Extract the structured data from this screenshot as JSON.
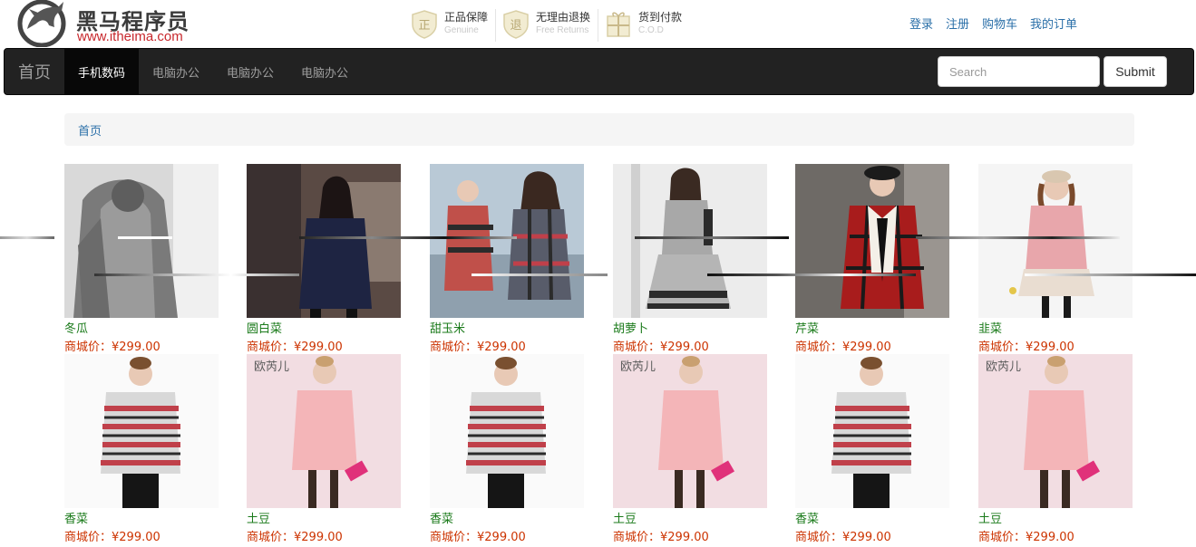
{
  "header": {
    "logo_text": "黑马程序员",
    "logo_url": "www.itheima.com",
    "promises": [
      {
        "icon": "genuine-shield-icon",
        "title": "正品保障",
        "subtitle": "Genuine"
      },
      {
        "icon": "return-shield-icon",
        "title": "无理由退换",
        "subtitle": "Free Returns"
      },
      {
        "icon": "gift-box-icon",
        "title": "货到付款",
        "subtitle": "C.O.D"
      }
    ],
    "links": [
      "登录",
      "注册",
      "购物车",
      "我的订单"
    ]
  },
  "navbar": {
    "brand": "首页",
    "items": [
      {
        "label": "手机数码",
        "active": true
      },
      {
        "label": "电脑办公",
        "active": false
      },
      {
        "label": "电脑办公",
        "active": false
      },
      {
        "label": "电脑办公",
        "active": false
      }
    ],
    "search_placeholder": "Search",
    "submit_label": "Submit"
  },
  "breadcrumb": {
    "home": "首页"
  },
  "products": [
    {
      "name": "冬瓜",
      "price": "商城价：¥299.00",
      "image": "grey-knit-sweater"
    },
    {
      "name": "圆白菜",
      "price": "商城价：¥299.00",
      "image": "navy-coat"
    },
    {
      "name": "甜玉米",
      "price": "商城价：¥299.00",
      "image": "plaid-coats"
    },
    {
      "name": "胡萝卜",
      "price": "商城价：¥299.00",
      "image": "grey-striped-dress"
    },
    {
      "name": "芹菜",
      "price": "商城价：¥299.00",
      "image": "red-plaid-coat"
    },
    {
      "name": "韭菜",
      "price": "商城价：¥299.00",
      "image": "pink-sweater-dress"
    },
    {
      "name": "香菜",
      "price": "商城价：¥299.00",
      "image": "reindeer-sweater"
    },
    {
      "name": "土豆",
      "price": "商城价：¥299.00",
      "image": "pink-coat"
    },
    {
      "name": "香菜",
      "price": "商城价：¥299.00",
      "image": "reindeer-sweater"
    },
    {
      "name": "土豆",
      "price": "商城价：¥299.00",
      "image": "pink-coat"
    },
    {
      "name": "香菜",
      "price": "商城价：¥299.00",
      "image": "reindeer-sweater"
    },
    {
      "name": "土豆",
      "price": "商城价：¥299.00",
      "image": "pink-coat"
    }
  ],
  "image_watermark": "欧芮儿",
  "colors": {
    "nav_bg": "#222222",
    "link": "#2a6fa8",
    "product_name": "#1a7a1a",
    "price": "#cc3300"
  }
}
